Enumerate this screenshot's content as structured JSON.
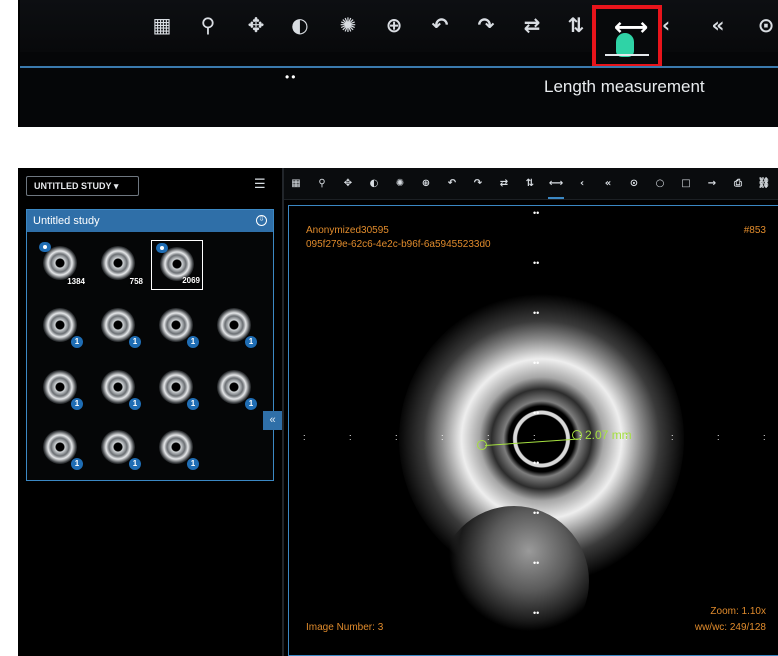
{
  "inset": {
    "tools": [
      "▦",
      "⚲",
      "✥",
      "◐",
      "✺",
      "⊕",
      "↶",
      "↷",
      "⇄",
      "⇅",
      "⟷",
      "‹",
      "«",
      "⊙"
    ],
    "caption": "Length measurement",
    "dots": "••"
  },
  "left_panel": {
    "study_select": "UNTITLED STUDY ▾",
    "list_icon": "☰",
    "panel_title": "Untitled study",
    "download_icon": "⇩",
    "thumbnails": [
      {
        "label": "1384",
        "eye": true
      },
      {
        "label": "758",
        "eye": false
      },
      {
        "label": "2069",
        "eye": true,
        "selected": true
      },
      {
        "label": "1"
      },
      {
        "label": "1"
      },
      {
        "label": "1"
      },
      {
        "label": "1"
      },
      {
        "label": "1"
      },
      {
        "label": "1"
      },
      {
        "label": "1"
      },
      {
        "label": "1"
      },
      {
        "label": "1"
      },
      {
        "label": "1"
      },
      {
        "label": "1"
      }
    ],
    "collapse_label": "«"
  },
  "viewer": {
    "tools": [
      "▦",
      "⚲",
      "✥",
      "◐",
      "✺",
      "⊕",
      "↶",
      "↷",
      "⇄",
      "⇅",
      "⟷",
      "‹",
      "«",
      "⊙",
      "○",
      "□",
      "→",
      "⎙",
      "⛓"
    ],
    "active_tool_index": 10,
    "patient_name": "Anonymized30595",
    "study_uid": "095f279e-62c6-4e2c-b96f-6a59455233d0",
    "instance_number": "#853",
    "image_number": "Image Number: 3",
    "zoom": "Zoom: 1.10x",
    "wwwc": "ww/wc: 249/128",
    "measurement": "2.07 mm"
  }
}
